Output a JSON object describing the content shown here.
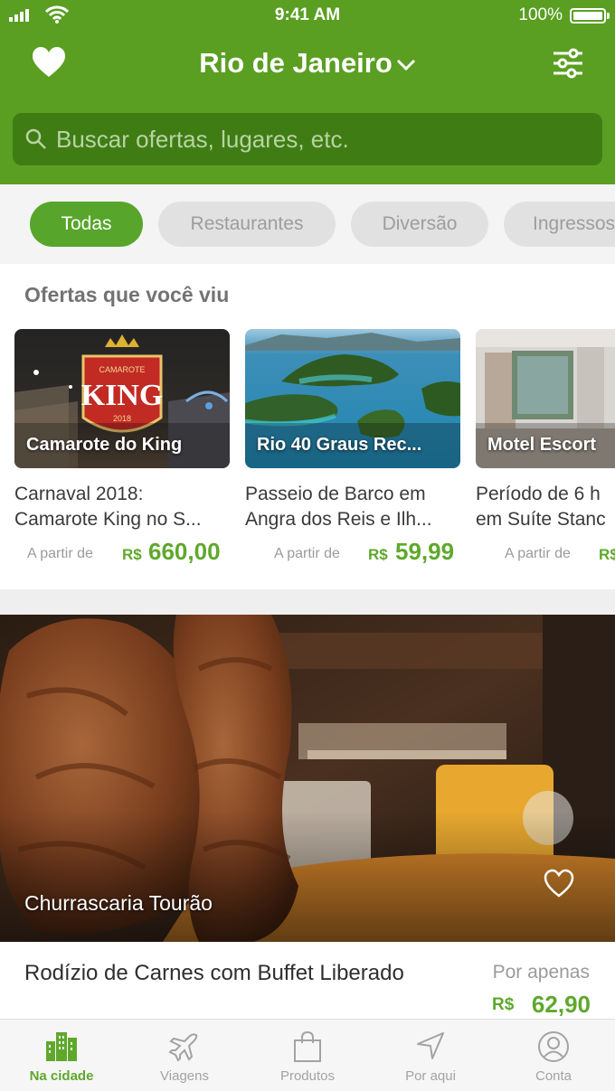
{
  "status": {
    "time": "9:41 AM",
    "battery": "100%"
  },
  "header": {
    "city": "Rio de Janeiro",
    "accent": "#5a9f22"
  },
  "search": {
    "placeholder": "Buscar ofertas, lugares, etc."
  },
  "categories": [
    {
      "label": "Todas",
      "active": true
    },
    {
      "label": "Restaurantes",
      "active": false
    },
    {
      "label": "Diversão",
      "active": false
    },
    {
      "label": "Ingressos",
      "active": false
    }
  ],
  "viewed": {
    "title": "Ofertas que você viu",
    "cards": [
      {
        "image_label": "Camarote do King",
        "badge_top": "CAMAROTE",
        "badge_main": "KING",
        "badge_year": "2018",
        "title_line1": "Carnaval 2018:",
        "title_line2": "Camarote King no S...",
        "from": "A partir de",
        "currency": "R$",
        "price": "660,00"
      },
      {
        "image_label": "Rio 40 Graus Rec...",
        "title_line1": "Passeio de Barco em",
        "title_line2": "Angra dos Reis e Ilh...",
        "from": "A partir de",
        "currency": "R$",
        "price": "59,99"
      },
      {
        "image_label": "Motel Escort",
        "title_line1": "Período de 6 h",
        "title_line2": "em Suíte Stanc",
        "from": "A partir de",
        "currency": "R$",
        "price": ""
      }
    ]
  },
  "featured": {
    "image_label": "Churrascaria Tourão",
    "title": "Rodízio de Carnes com Buffet Liberado",
    "by": "Por apenas",
    "currency": "R$",
    "price": "62,90"
  },
  "tabs": [
    {
      "label": "Na cidade",
      "icon": "city-icon",
      "active": true
    },
    {
      "label": "Viagens",
      "icon": "airplane-icon",
      "active": false
    },
    {
      "label": "Produtos",
      "icon": "shopping-bag-icon",
      "active": false
    },
    {
      "label": "Por aqui",
      "icon": "location-arrow-icon",
      "active": false
    },
    {
      "label": "Conta",
      "icon": "user-icon",
      "active": false
    }
  ]
}
